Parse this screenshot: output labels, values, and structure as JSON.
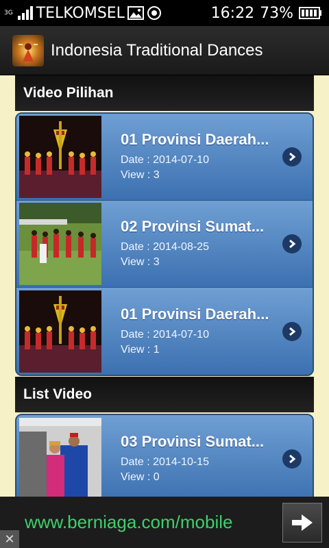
{
  "statusbar": {
    "network_tag": "3G",
    "carrier": "TELKOMSEL",
    "time": "16:22",
    "battery": "73%"
  },
  "actionbar": {
    "title": "Indonesia Traditional Dances"
  },
  "sections": {
    "featured_title": "Video Pilihan",
    "list_title": "List Video"
  },
  "featured_items": [
    {
      "title": "01 Provinsi Daerah...",
      "date": "Date : 2014-07-10",
      "views": "View : 3"
    },
    {
      "title": "02 Provinsi Sumat...",
      "date": "Date : 2014-08-25",
      "views": "View : 3"
    },
    {
      "title": "01 Provinsi Daerah...",
      "date": "Date : 2014-07-10",
      "views": "View : 1"
    }
  ],
  "list_items": [
    {
      "title": "03 Provinsi Sumat...",
      "date": "Date : 2014-10-15",
      "views": "View : 0"
    }
  ],
  "ad": {
    "text": "www.berniaga.com/mobile",
    "close": "✕"
  }
}
